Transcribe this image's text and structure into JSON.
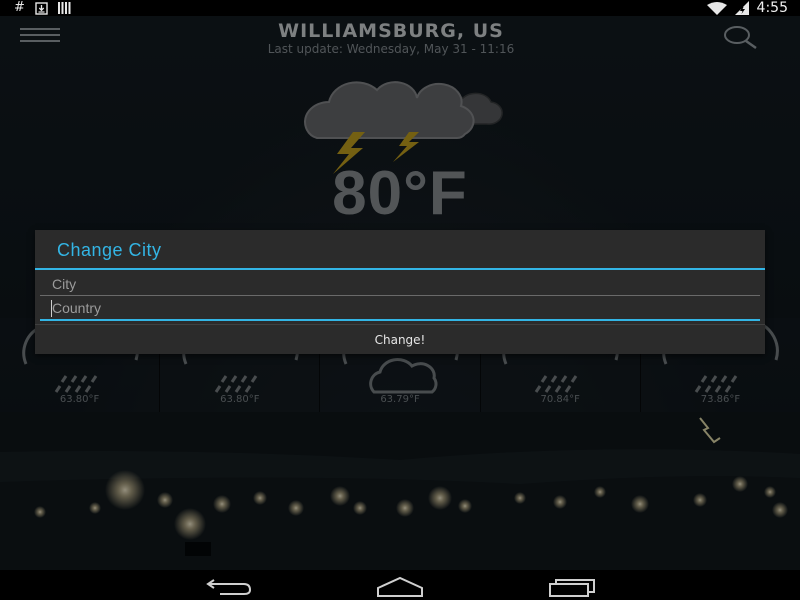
{
  "status_bar": {
    "left_icons": [
      "hash-icon",
      "download-icon",
      "barcode-icon"
    ],
    "hash_glyph": "#",
    "time": "4:55"
  },
  "header": {
    "city": "WILLIAMSBURG, US",
    "last_update": "Last update: Wednesday, May 31 - 11:16"
  },
  "current": {
    "temperature": "80°F",
    "icon": "thunderstorm-icon"
  },
  "forecast": [
    {
      "icon": "rain-cloud-icon",
      "temp": "63.80°F"
    },
    {
      "icon": "rain-cloud-icon",
      "temp": "63.80°F"
    },
    {
      "icon": "cloud-icon",
      "temp": "63.79°F"
    },
    {
      "icon": "rain-cloud-icon",
      "temp": "70.84°F"
    },
    {
      "icon": "rain-cloud-icon",
      "temp": "73.86°F"
    }
  ],
  "dialog": {
    "title": "Change City",
    "city_placeholder": "City",
    "country_placeholder": "Country",
    "button_label": "Change!"
  },
  "colors": {
    "accent": "#33b5e5",
    "dialog_bg": "#2b2b2b",
    "status_bar_bg": "#000000"
  },
  "nav_bar": {
    "buttons": [
      "back-icon",
      "home-icon",
      "recents-icon"
    ]
  }
}
